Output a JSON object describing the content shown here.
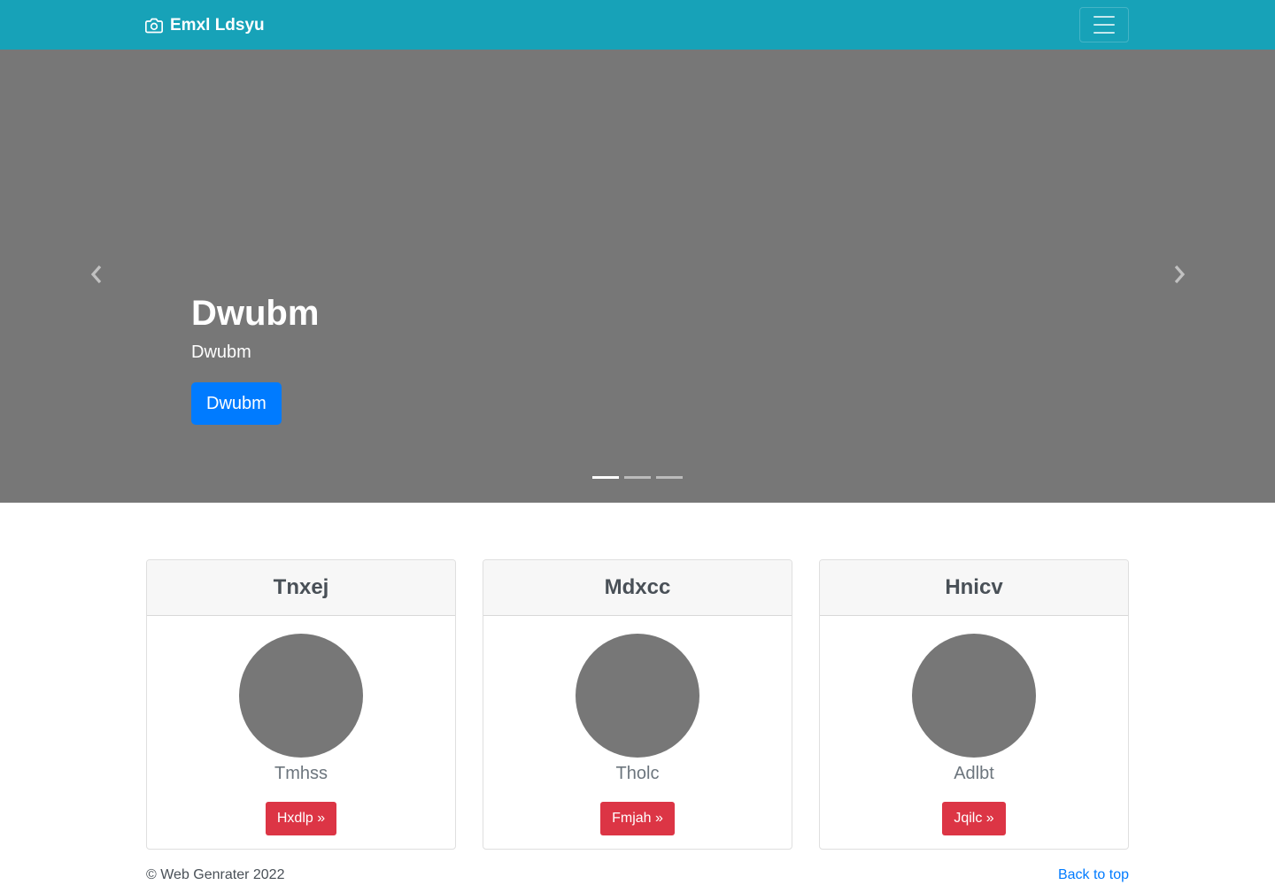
{
  "navbar": {
    "brand_icon": "camera-icon",
    "brand": "Emxl Ldsyu",
    "toggler_icon": "hamburger-menu-icon"
  },
  "carousel": {
    "prev_icon": "chevron-left-icon",
    "next_icon": "chevron-right-icon",
    "title": "Dwubm",
    "subtitle": "Dwubm",
    "button": "Dwubm",
    "slide_count": 3,
    "active_slide": 1,
    "background_color": "#777777"
  },
  "cards": [
    {
      "header": "Tnxej",
      "subtitle": "Tmhss",
      "button": "Hxdlp »"
    },
    {
      "header": "Mdxcc",
      "subtitle": "Tholc",
      "button": "Fmjah »"
    },
    {
      "header": "Hnicv",
      "subtitle": "Adlbt",
      "button": "Jqilc »"
    }
  ],
  "footer": {
    "copyright": "© Web Genrater 2022",
    "back_to_top": "Back to top"
  },
  "colors": {
    "navbar": "#17a2b8",
    "primary": "#007bff",
    "danger": "#dc3545",
    "placeholder": "#777777"
  }
}
